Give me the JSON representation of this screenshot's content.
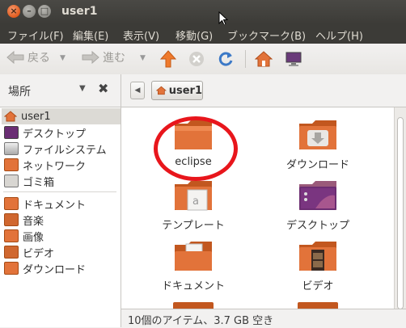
{
  "window": {
    "title": "user1"
  },
  "menu": [
    "ファイル(F)",
    "編集(E)",
    "表示(V)",
    "移動(G)",
    "ブックマーク(B)",
    "ヘルプ(H)"
  ],
  "toolbar": {
    "back": "戻る",
    "forward": "進む"
  },
  "sidebar": {
    "header": "場所",
    "places": [
      {
        "label": "user1",
        "icon": "home-icon"
      },
      {
        "label": "デスクトップ",
        "icon": "desktop-icon"
      },
      {
        "label": "ファイルシステム",
        "icon": "drive-icon"
      },
      {
        "label": "ネットワーク",
        "icon": "network-icon"
      },
      {
        "label": "ゴミ箱",
        "icon": "trash-icon"
      }
    ],
    "bookmarks": [
      {
        "label": "ドキュメント",
        "icon": "documents-folder-icon"
      },
      {
        "label": "音楽",
        "icon": "music-folder-icon"
      },
      {
        "label": "画像",
        "icon": "pictures-folder-icon"
      },
      {
        "label": "ビデオ",
        "icon": "videos-folder-icon"
      },
      {
        "label": "ダウンロード",
        "icon": "downloads-folder-icon"
      }
    ]
  },
  "pathbar": {
    "current": "user1"
  },
  "files": [
    {
      "label": "eclipse",
      "icon": "folder-icon"
    },
    {
      "label": "ダウンロード",
      "icon": "downloads-folder-icon"
    },
    {
      "label": "テンプレート",
      "icon": "templates-folder-icon"
    },
    {
      "label": "デスクトップ",
      "icon": "desktop-folder-icon"
    },
    {
      "label": "ドキュメント",
      "icon": "documents-folder-icon"
    },
    {
      "label": "ビデオ",
      "icon": "videos-folder-icon"
    }
  ],
  "status": "10個のアイテム、3.7 GB 空き",
  "colors": {
    "accent": "#e8161c",
    "folder": "#e2733a",
    "titlebar": "#3c3b37"
  }
}
